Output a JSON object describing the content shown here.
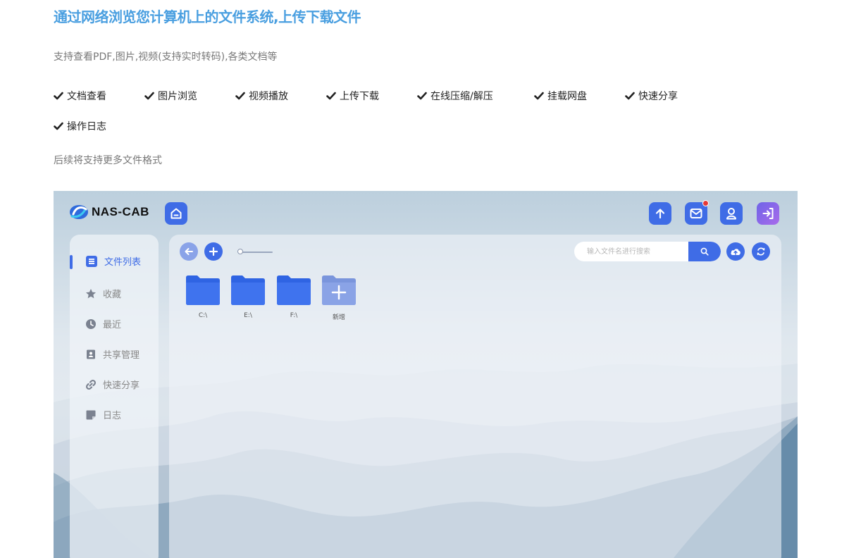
{
  "header": {
    "title": "通过网络浏览您计算机上的文件系统,上传下载文件",
    "subtitle": "支持查看PDF,图片,视频(支持实时转码),各类文档等",
    "note": "后续将支持更多文件格式"
  },
  "features": [
    {
      "label": "文档查看"
    },
    {
      "label": "图片浏览"
    },
    {
      "label": "视频播放"
    },
    {
      "label": "上传下载"
    },
    {
      "label": "在线压缩/解压"
    },
    {
      "label": "挂载网盘"
    },
    {
      "label": "快速分享"
    },
    {
      "label": "操作日志"
    }
  ],
  "app": {
    "logo": "NAS-CAB",
    "sidebar": {
      "items": [
        {
          "label": "文件列表",
          "icon": "file-list-icon",
          "active": true
        },
        {
          "label": "收藏",
          "icon": "star-icon"
        },
        {
          "label": "最近",
          "icon": "clock-icon"
        },
        {
          "label": "共享管理",
          "icon": "share-manage-icon"
        },
        {
          "label": "快速分享",
          "icon": "link-icon"
        },
        {
          "label": "日志",
          "icon": "note-icon"
        }
      ]
    },
    "search": {
      "placeholder": "输入文件名进行搜索"
    },
    "folders": [
      {
        "label": "C:\\"
      },
      {
        "label": "E:\\"
      },
      {
        "label": "F:\\"
      },
      {
        "label": "新增"
      }
    ],
    "colors": {
      "accent": "#3f6ce6",
      "title": "#4a9fe0",
      "notification": "#e53935"
    }
  }
}
